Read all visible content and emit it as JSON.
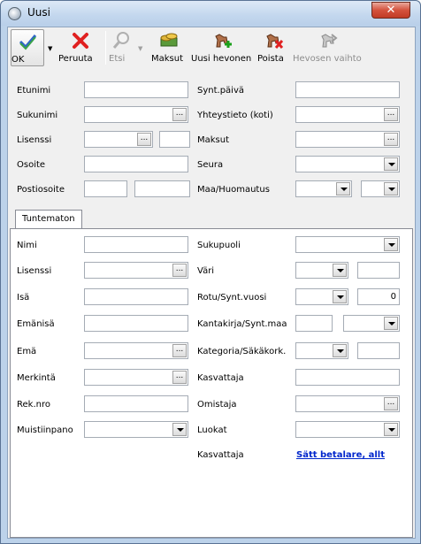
{
  "window": {
    "title": "Uusi",
    "close_glyph": "✕"
  },
  "toolbar": {
    "buttons": [
      {
        "label": "OK",
        "icon": "check-icon"
      },
      {
        "label": "Peruuta",
        "icon": "red-x-icon"
      },
      {
        "label": "Etsi",
        "icon": "magnifier-icon",
        "disabled": true
      },
      {
        "label": "Maksut",
        "icon": "money-icon"
      },
      {
        "label": "Uusi hevonen",
        "icon": "horse-add-icon"
      },
      {
        "label": "Poista",
        "icon": "horse-delete-icon"
      },
      {
        "label": "Hevosen vaihto",
        "icon": "horse-swap-icon",
        "disabled": true
      }
    ]
  },
  "owner": {
    "etunimi": "Etunimi",
    "sukunimi": "Sukunimi",
    "lisenssi": "Lisenssi",
    "osoite": "Osoite",
    "postiosoite": "Postiosoite",
    "synt_paiva": "Synt.päivä",
    "yhteystieto": "Yhteystieto (koti)",
    "maksut": "Maksut",
    "seura": "Seura",
    "maa_huomautus": "Maa/Huomautus"
  },
  "tabs": [
    {
      "label": "Tuntematon"
    }
  ],
  "horse": {
    "nimi": "Nimi",
    "lisenssi": "Lisenssi",
    "isa": "Isä",
    "emanisa": "Emänisä",
    "ema": "Emä",
    "merkinta": "Merkintä",
    "rek_nro": "Rek.nro",
    "muistiinpano": "Muistiinpano",
    "sukupuoli": "Sukupuoli",
    "vari": "Väri",
    "rotu_synt": "Rotu/Synt.vuosi",
    "rotu_synt_value": "0",
    "kantakirja": "Kantakirja/Synt.maa",
    "kategoria": "Kategoria/Säkäkork.",
    "kasvattaja": "Kasvattaja",
    "omistaja": "Omistaja",
    "luokat": "Luokat",
    "kasvattaja2": "Kasvattaja",
    "link": "Sätt betalare, allt"
  },
  "colors": {
    "accent": "#0026cc",
    "close": "#c13b25"
  }
}
